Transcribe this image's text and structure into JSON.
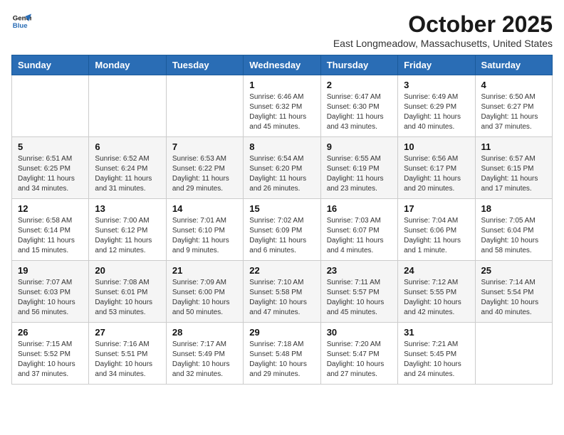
{
  "logo": {
    "line1": "General",
    "line2": "Blue"
  },
  "title": "October 2025",
  "location": "East Longmeadow, Massachusetts, United States",
  "weekdays": [
    "Sunday",
    "Monday",
    "Tuesday",
    "Wednesday",
    "Thursday",
    "Friday",
    "Saturday"
  ],
  "weeks": [
    [
      {
        "day": "",
        "info": ""
      },
      {
        "day": "",
        "info": ""
      },
      {
        "day": "",
        "info": ""
      },
      {
        "day": "1",
        "info": "Sunrise: 6:46 AM\nSunset: 6:32 PM\nDaylight: 11 hours and 45 minutes."
      },
      {
        "day": "2",
        "info": "Sunrise: 6:47 AM\nSunset: 6:30 PM\nDaylight: 11 hours and 43 minutes."
      },
      {
        "day": "3",
        "info": "Sunrise: 6:49 AM\nSunset: 6:29 PM\nDaylight: 11 hours and 40 minutes."
      },
      {
        "day": "4",
        "info": "Sunrise: 6:50 AM\nSunset: 6:27 PM\nDaylight: 11 hours and 37 minutes."
      }
    ],
    [
      {
        "day": "5",
        "info": "Sunrise: 6:51 AM\nSunset: 6:25 PM\nDaylight: 11 hours and 34 minutes."
      },
      {
        "day": "6",
        "info": "Sunrise: 6:52 AM\nSunset: 6:24 PM\nDaylight: 11 hours and 31 minutes."
      },
      {
        "day": "7",
        "info": "Sunrise: 6:53 AM\nSunset: 6:22 PM\nDaylight: 11 hours and 29 minutes."
      },
      {
        "day": "8",
        "info": "Sunrise: 6:54 AM\nSunset: 6:20 PM\nDaylight: 11 hours and 26 minutes."
      },
      {
        "day": "9",
        "info": "Sunrise: 6:55 AM\nSunset: 6:19 PM\nDaylight: 11 hours and 23 minutes."
      },
      {
        "day": "10",
        "info": "Sunrise: 6:56 AM\nSunset: 6:17 PM\nDaylight: 11 hours and 20 minutes."
      },
      {
        "day": "11",
        "info": "Sunrise: 6:57 AM\nSunset: 6:15 PM\nDaylight: 11 hours and 17 minutes."
      }
    ],
    [
      {
        "day": "12",
        "info": "Sunrise: 6:58 AM\nSunset: 6:14 PM\nDaylight: 11 hours and 15 minutes."
      },
      {
        "day": "13",
        "info": "Sunrise: 7:00 AM\nSunset: 6:12 PM\nDaylight: 11 hours and 12 minutes."
      },
      {
        "day": "14",
        "info": "Sunrise: 7:01 AM\nSunset: 6:10 PM\nDaylight: 11 hours and 9 minutes."
      },
      {
        "day": "15",
        "info": "Sunrise: 7:02 AM\nSunset: 6:09 PM\nDaylight: 11 hours and 6 minutes."
      },
      {
        "day": "16",
        "info": "Sunrise: 7:03 AM\nSunset: 6:07 PM\nDaylight: 11 hours and 4 minutes."
      },
      {
        "day": "17",
        "info": "Sunrise: 7:04 AM\nSunset: 6:06 PM\nDaylight: 11 hours and 1 minute."
      },
      {
        "day": "18",
        "info": "Sunrise: 7:05 AM\nSunset: 6:04 PM\nDaylight: 10 hours and 58 minutes."
      }
    ],
    [
      {
        "day": "19",
        "info": "Sunrise: 7:07 AM\nSunset: 6:03 PM\nDaylight: 10 hours and 56 minutes."
      },
      {
        "day": "20",
        "info": "Sunrise: 7:08 AM\nSunset: 6:01 PM\nDaylight: 10 hours and 53 minutes."
      },
      {
        "day": "21",
        "info": "Sunrise: 7:09 AM\nSunset: 6:00 PM\nDaylight: 10 hours and 50 minutes."
      },
      {
        "day": "22",
        "info": "Sunrise: 7:10 AM\nSunset: 5:58 PM\nDaylight: 10 hours and 47 minutes."
      },
      {
        "day": "23",
        "info": "Sunrise: 7:11 AM\nSunset: 5:57 PM\nDaylight: 10 hours and 45 minutes."
      },
      {
        "day": "24",
        "info": "Sunrise: 7:12 AM\nSunset: 5:55 PM\nDaylight: 10 hours and 42 minutes."
      },
      {
        "day": "25",
        "info": "Sunrise: 7:14 AM\nSunset: 5:54 PM\nDaylight: 10 hours and 40 minutes."
      }
    ],
    [
      {
        "day": "26",
        "info": "Sunrise: 7:15 AM\nSunset: 5:52 PM\nDaylight: 10 hours and 37 minutes."
      },
      {
        "day": "27",
        "info": "Sunrise: 7:16 AM\nSunset: 5:51 PM\nDaylight: 10 hours and 34 minutes."
      },
      {
        "day": "28",
        "info": "Sunrise: 7:17 AM\nSunset: 5:49 PM\nDaylight: 10 hours and 32 minutes."
      },
      {
        "day": "29",
        "info": "Sunrise: 7:18 AM\nSunset: 5:48 PM\nDaylight: 10 hours and 29 minutes."
      },
      {
        "day": "30",
        "info": "Sunrise: 7:20 AM\nSunset: 5:47 PM\nDaylight: 10 hours and 27 minutes."
      },
      {
        "day": "31",
        "info": "Sunrise: 7:21 AM\nSunset: 5:45 PM\nDaylight: 10 hours and 24 minutes."
      },
      {
        "day": "",
        "info": ""
      }
    ]
  ]
}
